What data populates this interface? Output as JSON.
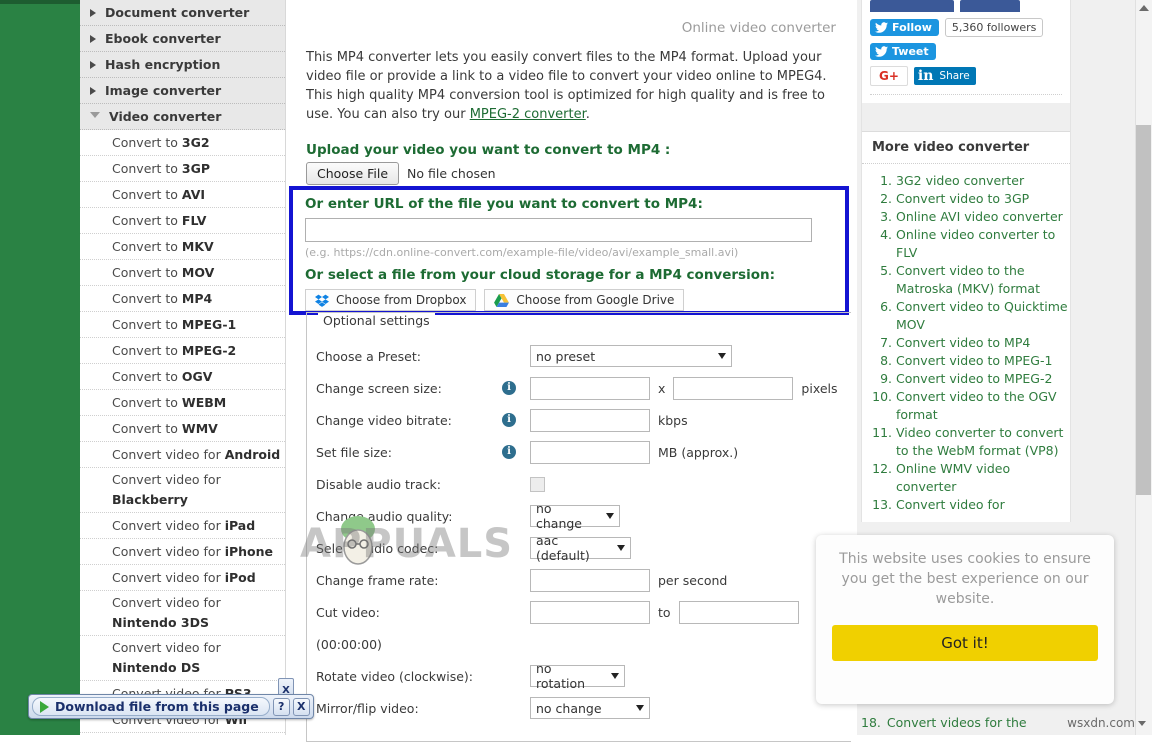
{
  "colors": {
    "green_band": "#2a8244",
    "heading_green": "#1d6b33",
    "link_green": "#2f7c3e",
    "highlight_blue": "#1414d2",
    "cookie_yellow": "#f0d000",
    "twitter_blue": "#1b95e0",
    "linkedin_blue": "#0077b5",
    "facebook_blue": "#3b5998"
  },
  "sidebar": {
    "groups": [
      {
        "label": "Document converter",
        "state": "collapsed",
        "icon": "chevron-right-icon"
      },
      {
        "label": "Ebook converter",
        "state": "collapsed",
        "icon": "chevron-right-icon"
      },
      {
        "label": "Hash encryption",
        "state": "collapsed",
        "icon": "chevron-right-icon"
      },
      {
        "label": "Image converter",
        "state": "collapsed",
        "icon": "chevron-right-icon"
      },
      {
        "label": "Video converter",
        "state": "expanded",
        "icon": "chevron-down-icon"
      }
    ],
    "items": [
      {
        "prefix": "Convert to ",
        "strong": "3G2"
      },
      {
        "prefix": "Convert to ",
        "strong": "3GP"
      },
      {
        "prefix": "Convert to ",
        "strong": "AVI"
      },
      {
        "prefix": "Convert to ",
        "strong": "FLV"
      },
      {
        "prefix": "Convert to ",
        "strong": "MKV"
      },
      {
        "prefix": "Convert to ",
        "strong": "MOV"
      },
      {
        "prefix": "Convert to ",
        "strong": "MP4"
      },
      {
        "prefix": "Convert to ",
        "strong": "MPEG-1"
      },
      {
        "prefix": "Convert to ",
        "strong": "MPEG-2"
      },
      {
        "prefix": "Convert to ",
        "strong": "OGV"
      },
      {
        "prefix": "Convert to ",
        "strong": "WEBM"
      },
      {
        "prefix": "Convert to ",
        "strong": "WMV"
      },
      {
        "prefix": "Convert video for ",
        "strong": "Android"
      },
      {
        "prefix": "Convert video for ",
        "strong": "Blackberry",
        "wrap": true
      },
      {
        "prefix": "Convert video for ",
        "strong": "iPad"
      },
      {
        "prefix": "Convert video for ",
        "strong": "iPhone"
      },
      {
        "prefix": "Convert video for ",
        "strong": "iPod"
      },
      {
        "prefix": "Convert video for ",
        "strong": "Nintendo 3DS",
        "wrap": true
      },
      {
        "prefix": "Convert video for ",
        "strong": "Nintendo DS",
        "wrap": true
      },
      {
        "prefix": "Convert video for ",
        "strong": "PS3"
      },
      {
        "prefix": "Convert video for ",
        "strong": "Wii"
      }
    ]
  },
  "main": {
    "page_title": "Online video converter",
    "intro_part1": "This MP4 converter lets you easily convert files to the MP4 format. Upload your video file or provide a link to a video file to convert your video online to MPEG4. This high quality MP4 conversion tool is optimized for high quality and is free to use. You can also try our ",
    "intro_link": "MPEG-2 converter",
    "intro_part2": ".",
    "upload_label": "Upload your video you want to convert to MP4 :",
    "choose_file_button": "Choose File",
    "no_file_chosen": "No file chosen",
    "url_label": "Or enter URL of the file you want to convert to MP4:",
    "url_value": "",
    "url_hint": "(e.g. https://cdn.online-convert.com/example-file/video/avi/example_small.avi)",
    "cloud_label": "Or select a file from your cloud storage for a MP4 conversion:",
    "dropbox_button": "Choose from Dropbox",
    "gdrive_button": "Choose from Google Drive",
    "optional_legend": "Optional settings",
    "fields": [
      {
        "label": "Choose a Preset:",
        "type": "select",
        "value": "no preset",
        "info": false
      },
      {
        "label": "Change screen size:",
        "type": "size",
        "value": "",
        "value2": "",
        "sep": "x",
        "unit": "pixels",
        "info": true
      },
      {
        "label": "Change video bitrate:",
        "type": "text",
        "value": "",
        "unit": "kbps",
        "info": true
      },
      {
        "label": "Set file size:",
        "type": "text",
        "value": "",
        "unit": "MB (approx.)",
        "info": true
      },
      {
        "label": "Disable audio track:",
        "type": "checkbox",
        "value": "",
        "checked": false,
        "info": false
      },
      {
        "label": "Change audio quality:",
        "type": "select",
        "value": "no change",
        "info": false
      },
      {
        "label": "Select audio codec:",
        "type": "select",
        "value": "aac (default)",
        "info": false
      },
      {
        "label": "Change frame rate:",
        "type": "text",
        "value": "",
        "unit": "per second",
        "info": false
      },
      {
        "label": "Cut video:",
        "type": "range",
        "value": "",
        "value2": "",
        "sep": "to",
        "info": false
      },
      {
        "label": "(00:00:00)",
        "type": "note",
        "info": false
      },
      {
        "label": "Rotate video (clockwise):",
        "type": "select",
        "value": "no rotation",
        "info": false
      },
      {
        "label": "Mirror/flip video:",
        "type": "select",
        "value": "no change",
        "info": false
      }
    ]
  },
  "right": {
    "social": {
      "follow_label": "Follow",
      "followers_count": "5,360 followers",
      "tweet_label": "Tweet",
      "gplus_label": "G+",
      "linkedin_icon_label": "in",
      "linkedin_share_label": "Share"
    },
    "more_title": "More video converter",
    "more_items": [
      "3G2 video converter",
      "Convert video to 3GP",
      "Online AVI video converter",
      "Online video converter to FLV",
      "Convert video to the Matroska (MKV) format",
      "Convert video to Quicktime MOV",
      "Convert video to MP4",
      "Convert video to MPEG-1",
      "Convert video to MPEG-2",
      "Convert video to the OGV format",
      "Video converter to convert to the WebM format (VP8)",
      "Online WMV video converter",
      "Convert video for"
    ],
    "last_item_number": "18.",
    "last_item_text": "Convert videos for the"
  },
  "cookie": {
    "message": "This website uses cookies to ensure you get the best experience on our website.",
    "accept_label": "Got it!"
  },
  "download_widget": {
    "label": "Download file from this page",
    "help_label": "?",
    "close_label": "X",
    "side_close_label": "X"
  },
  "watermarks": {
    "bottom_right": "wsxdn.com",
    "center": "APPUALS"
  }
}
